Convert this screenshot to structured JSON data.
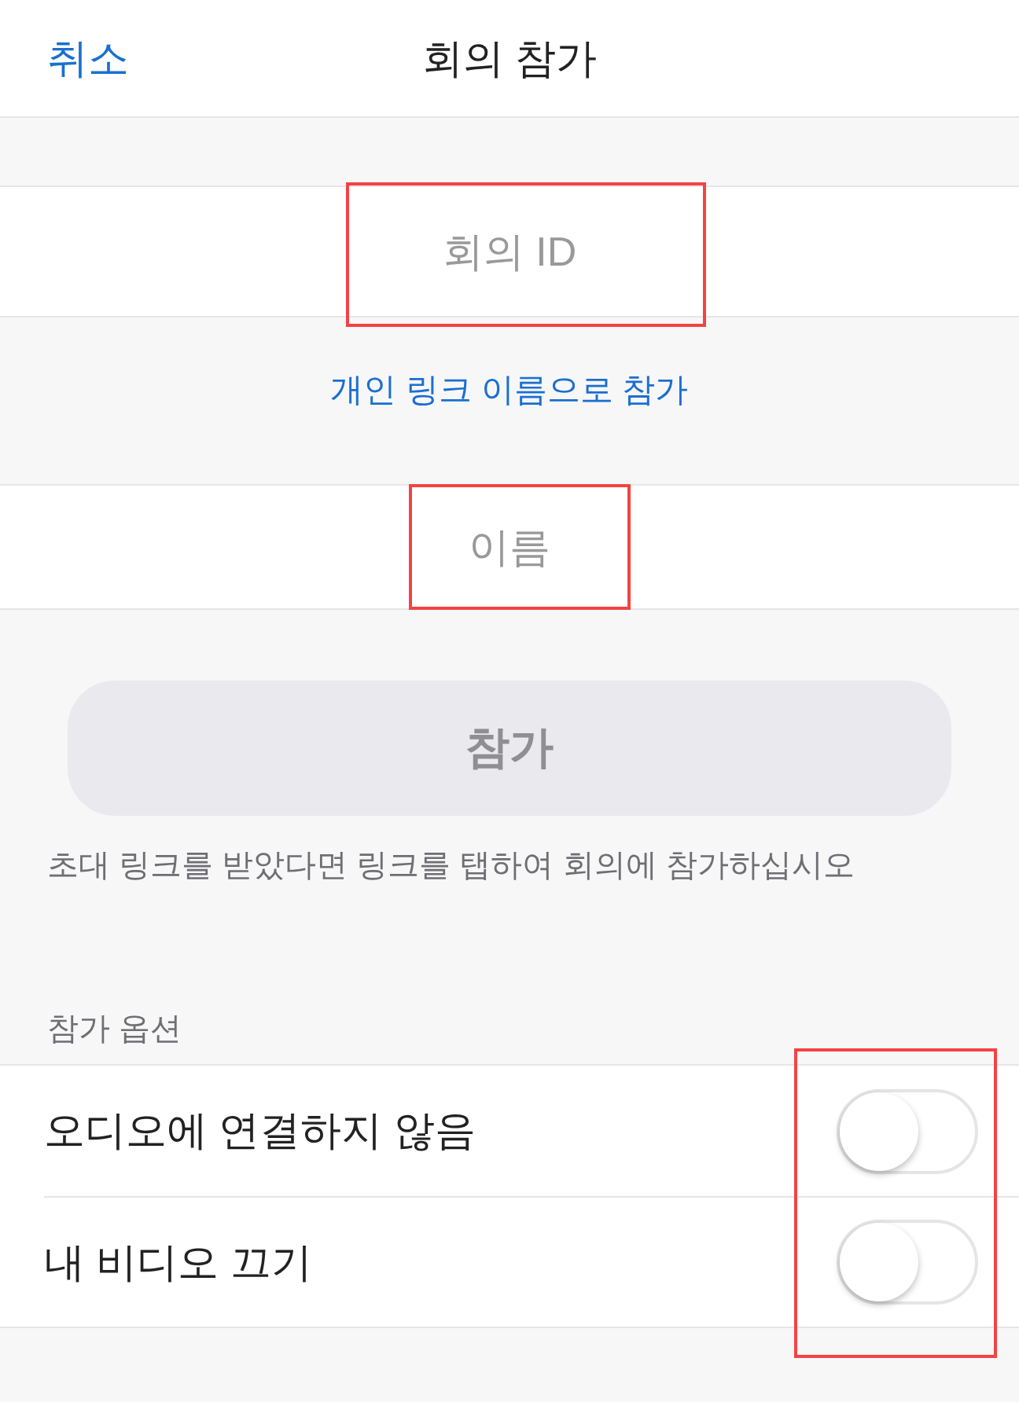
{
  "header": {
    "cancel": "취소",
    "title": "회의 참가"
  },
  "meeting_id_field": {
    "placeholder": "회의 ID",
    "highlighted": true
  },
  "personal_link": "개인 링크 이름으로 참가",
  "name_field": {
    "placeholder": "이름",
    "highlighted": true
  },
  "join_button": {
    "label": "참가",
    "disabled": true
  },
  "hint": "초대 링크를 받았다면 링크를 탭하여 회의에 참가하십시오",
  "options": {
    "title": "참가 옵션",
    "toggles_highlighted": true,
    "items": [
      {
        "label": "오디오에 연결하지 않음",
        "on": false
      },
      {
        "label": "내 비디오 끄기",
        "on": false
      }
    ]
  }
}
